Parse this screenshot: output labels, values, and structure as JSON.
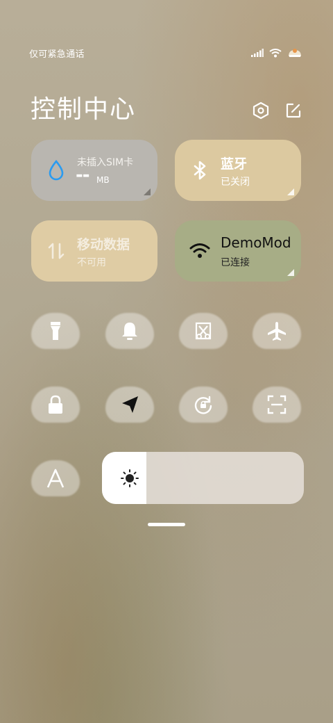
{
  "status_bar": {
    "carrier": "仅可紧急通话",
    "icons": [
      "signal-icon",
      "wifi-icon",
      "battery-icon"
    ]
  },
  "header": {
    "title": "控制中心",
    "settings_icon": "settings-hex-icon",
    "edit_icon": "edit-icon"
  },
  "cards": {
    "data_usage": {
      "label": "未插入SIM卡",
      "value": "--",
      "unit": "MB",
      "icon": "water-drop-icon",
      "color": "#b9b6b0"
    },
    "bluetooth": {
      "label": "蓝牙",
      "status": "已关闭",
      "icon": "bluetooth-icon",
      "color": "#dcc9a0"
    },
    "mobile_data": {
      "label": "移动数据",
      "status": "不可用",
      "icon": "data-arrows-icon",
      "color": "#dfcca4"
    },
    "wifi": {
      "label": "DemoMod",
      "status": "已连接",
      "icon": "wifi-icon",
      "color": "#a7ad86"
    }
  },
  "tiles": [
    {
      "name": "flashlight",
      "icon": "flashlight-icon"
    },
    {
      "name": "ring",
      "icon": "bell-icon"
    },
    {
      "name": "screenshot",
      "icon": "scissors-icon"
    },
    {
      "name": "airplane",
      "icon": "airplane-icon"
    },
    {
      "name": "lock",
      "icon": "lock-icon"
    },
    {
      "name": "location",
      "icon": "location-arrow-icon"
    },
    {
      "name": "rotation",
      "icon": "rotate-lock-icon"
    },
    {
      "name": "scanner",
      "icon": "scan-icon"
    },
    {
      "name": "font",
      "icon": "font-a-icon"
    }
  ],
  "brightness": {
    "icon": "sun-icon",
    "level": 0.22
  }
}
